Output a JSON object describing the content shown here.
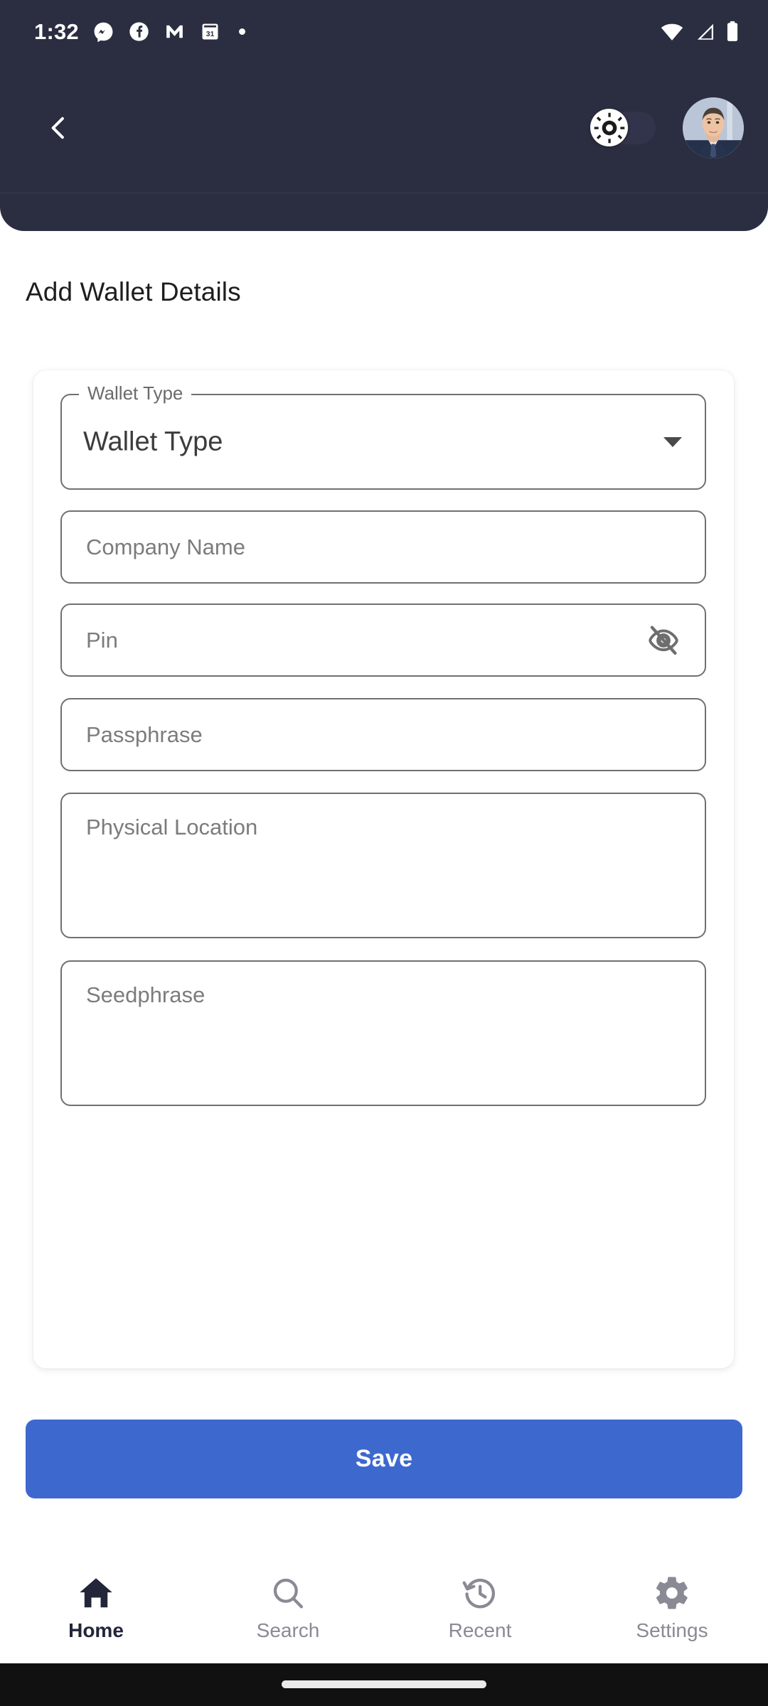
{
  "status_bar": {
    "time": "1:32",
    "left_icons": [
      "messenger-icon",
      "facebook-icon",
      "gmail-icon",
      "calendar-icon",
      "notification-dot-icon"
    ],
    "calendar_day": "31",
    "right_icons": [
      "wifi-icon",
      "cellular-signal-icon",
      "battery-icon"
    ]
  },
  "header": {
    "back_icon": "chevron-left-icon",
    "theme_toggle": {
      "icon": "sun-icon",
      "state": "off",
      "track_color": "#31344A",
      "knob_color": "#FFFFFF"
    },
    "avatar": "user-profile-avatar",
    "background_color": "#2B2E40"
  },
  "page": {
    "title": "Add Wallet Details"
  },
  "form": {
    "wallet_type": {
      "label": "Wallet Type",
      "value": "Wallet Type",
      "caret_icon": "chevron-down-icon"
    },
    "company_name": {
      "placeholder": "Company Name",
      "value": ""
    },
    "pin": {
      "placeholder": "Pin",
      "value": "",
      "toggle_icon": "eye-off-icon"
    },
    "passphrase": {
      "placeholder": "Passphrase",
      "value": ""
    },
    "physical_location": {
      "placeholder": "Physical Location",
      "value": ""
    },
    "seedphrase": {
      "placeholder": "Seedphrase",
      "value": ""
    }
  },
  "actions": {
    "save_label": "Save",
    "save_color": "#3D68CE"
  },
  "bottom_nav": {
    "items": [
      {
        "label": "Home",
        "icon": "home-icon",
        "active": true
      },
      {
        "label": "Search",
        "icon": "search-icon",
        "active": false
      },
      {
        "label": "Recent",
        "icon": "history-icon",
        "active": false
      },
      {
        "label": "Settings",
        "icon": "gear-icon",
        "active": false
      }
    ],
    "active_color": "#232639",
    "inactive_color": "#8A8A95"
  },
  "system": {
    "gesture_bar": "home-gesture-pill"
  }
}
